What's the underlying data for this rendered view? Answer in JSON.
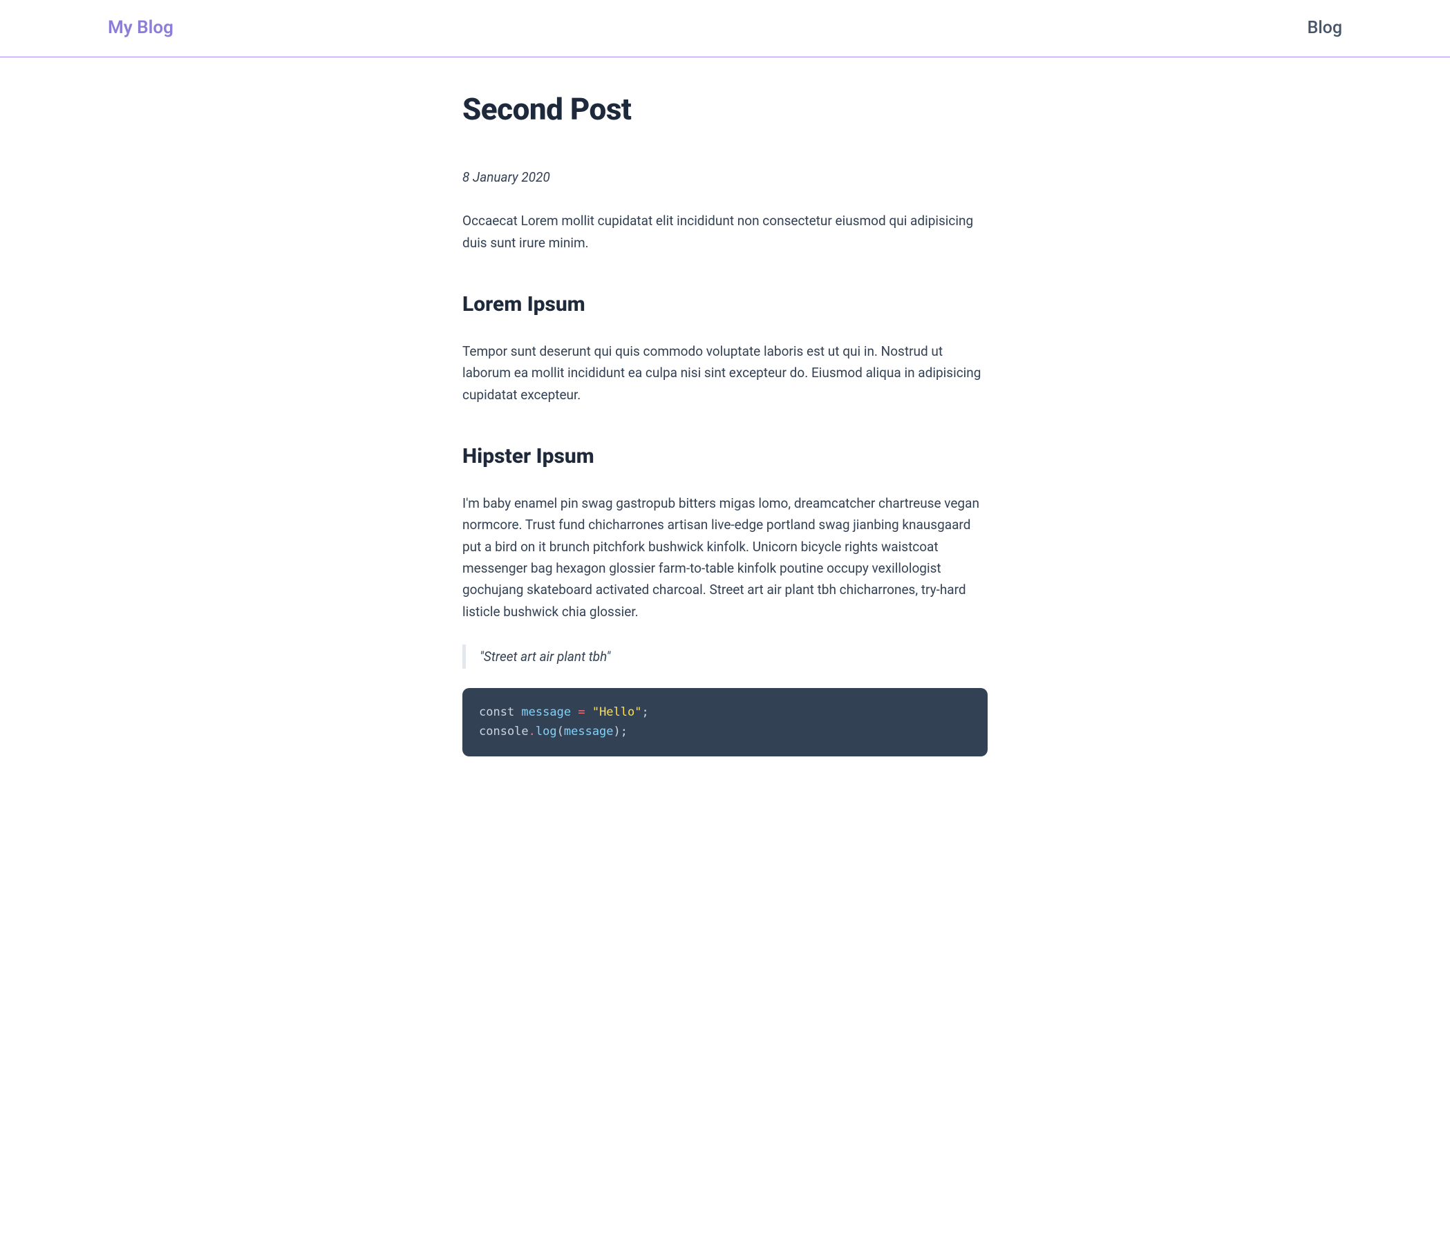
{
  "header": {
    "site_title": "My Blog",
    "nav_link": "Blog"
  },
  "post": {
    "title": "Second Post",
    "date": "8 January 2020",
    "intro": "Occaecat Lorem mollit cupidatat elit incididunt non consectetur eiusmod qui adipisicing duis sunt irure minim.",
    "sections": [
      {
        "heading": "Lorem Ipsum",
        "body": "Tempor sunt deserunt qui quis commodo voluptate laboris est ut qui in. Nostrud ut laborum ea mollit incididunt ea culpa nisi sint excepteur do. Eiusmod aliqua in adipisicing cupidatat excepteur."
      },
      {
        "heading": "Hipster Ipsum",
        "body": "I'm baby enamel pin swag gastropub bitters migas lomo, dreamcatcher chartreuse vegan normcore. Trust fund chicharrones artisan live-edge portland swag jianbing knausgaard put a bird on it brunch pitchfork bushwick kinfolk. Unicorn bicycle rights waistcoat messenger bag hexagon glossier farm-to-table kinfolk poutine occupy vexillologist gochujang skateboard activated charcoal. Street art air plant tbh chicharrones, try-hard listicle bushwick chia glossier."
      }
    ],
    "blockquote": "\"Street art air plant tbh\"",
    "code": {
      "tokens": [
        {
          "t": "const ",
          "c": "tok-keyword"
        },
        {
          "t": "message",
          "c": "tok-var"
        },
        {
          "t": " ",
          "c": "tok-punct"
        },
        {
          "t": "=",
          "c": "tok-op"
        },
        {
          "t": " ",
          "c": "tok-punct"
        },
        {
          "t": "\"Hello\"",
          "c": "tok-string"
        },
        {
          "t": ";",
          "c": "tok-punct"
        },
        {
          "t": "\n",
          "c": ""
        },
        {
          "t": "console",
          "c": "tok-obj"
        },
        {
          "t": ".",
          "c": "tok-op"
        },
        {
          "t": "log",
          "c": "tok-method"
        },
        {
          "t": "(",
          "c": "tok-punct"
        },
        {
          "t": "message",
          "c": "tok-var"
        },
        {
          "t": ")",
          "c": "tok-punct"
        },
        {
          "t": ";",
          "c": "tok-punct"
        }
      ]
    }
  }
}
